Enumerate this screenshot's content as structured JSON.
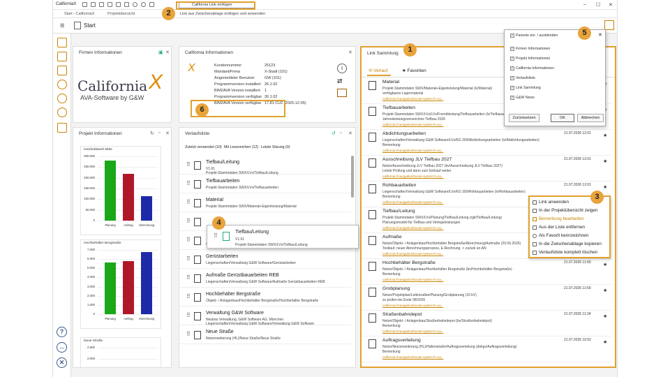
{
  "app": {
    "title": "CaliforniaX",
    "tab_start": "Start - CaliforniaX",
    "tab_projects": "Projektübersicht",
    "url_text": "California Link einfügen",
    "url_tooltip": "Link aus Zwischenablage einfügen und anwenden",
    "start": "Start"
  },
  "badges": [
    "1",
    "2",
    "3",
    "4",
    "5",
    "6"
  ],
  "firmen": {
    "title": "Firmen Informationen",
    "logo_word": "California",
    "logo_sub": "AVA-Software by G&W",
    "logo_x": "X"
  },
  "cinfo": {
    "title": "California Informationen",
    "rows": [
      {
        "k": "Kundennummer",
        "v": "25123"
      },
      {
        "k": "Mandant/Firma",
        "v": "X-Stadt (101)"
      },
      {
        "k": "Angemeldeter Benutzer",
        "v": "GW (101)"
      },
      {
        "k": "Programmversion installiert",
        "v": "26.1.02"
      },
      {
        "k": "BIM2AVA Version installiert",
        "v": "1"
      },
      {
        "k": "Programmversion verfügbar",
        "v": "26.1.02"
      },
      {
        "k": "BIM2AVA Version verfügbar",
        "v": "17.81 CU2 (2025-12-05)"
      }
    ]
  },
  "projekt": {
    "title": "Projekt Informationen",
    "charts": [
      {
        "title": "Heizkraftwerk Mitte",
        "yticks": [
          "300.000",
          "250.000",
          "200.000",
          "150.000",
          "100.000",
          "50.000",
          "0"
        ]
      },
      {
        "title": "Hochbehälter Bergstraße",
        "yticks": [
          "7.000",
          "6.000",
          "5.000",
          "4.000",
          "3.000",
          "2.000",
          "1.000",
          "0"
        ]
      },
      {
        "title": "Neue Straße",
        "yticks": [
          "2.500",
          "2.000"
        ]
      }
    ]
  },
  "chart_data": [
    {
      "type": "bar",
      "title": "Heizkraftwerk Mitte",
      "categories": [
        "Planung",
        "Auftrag",
        "Abrechnung"
      ],
      "values": [
        280000,
        220000,
        115000
      ],
      "ylim": [
        0,
        300000
      ],
      "colors": [
        "#1aa81a",
        "#b0182a",
        "#1c2aa8"
      ]
    },
    {
      "type": "bar",
      "title": "Hochbehälter Bergstraße",
      "categories": [
        "Planung",
        "Auftrag",
        "Abrechnung"
      ],
      "values": [
        5600,
        5800,
        6800
      ],
      "ylim": [
        0,
        7000
      ],
      "colors": [
        "#1aa81a",
        "#b0182a",
        "#1c2aa8"
      ]
    }
  ],
  "verlauf": {
    "title": "Verlaufsliste",
    "filters": [
      "Zuletzt verwendet (10)",
      "Mit Lesezeichen (12)",
      "Letzte Sitzung (0)"
    ],
    "items": [
      {
        "n": "Tiefbau/Leitung",
        "s": "V1.61",
        "s2": "Projekt-Stammdaten SWX/LVs/Tiefbau/Leitung"
      },
      {
        "n": "Tiefbauarbeiten",
        "s": "Projekt-Stammdaten SWX/LVs/Tiefbauarbeiten",
        "s2": ""
      },
      {
        "n": "Material",
        "s": "Projekt-Stammdaten SWX/Material+Eigenleistung/Material",
        "s2": ""
      },
      {
        "n": "",
        "s": "",
        "s2": ""
      },
      {
        "n": "",
        "s": "Objekt- / Anlagenbau/Heizkraftwerk Mitte/Heizkraftwerk Mitte",
        "s2": ""
      },
      {
        "n": "Gerüstarbeiten",
        "s": "Liegenschaften/Verwaltung G&W Software/Gerüstarbeiten",
        "s2": ""
      },
      {
        "n": "Aufmaße Gerüstbauarbeiten REB",
        "s": "Liegenschaften/Verwaltung G&W Software/Aufmaße Gerüstbauarbeiten REB",
        "s2": ""
      },
      {
        "n": "Hochbehälter Bergstraße",
        "s": "Objekt- / Anlagenbau/Hochbehälter Bergstraße/Hochbehälter Bergstraße",
        "s2": ""
      },
      {
        "n": "Verwaltung G&W Software",
        "s": "Neubau Verwaltung, G&W Software AG, München",
        "s2": "Liegenschaften/Verwaltung G&W Software/Verwaltung G&W Software"
      },
      {
        "n": "Neue Straße",
        "s": "Netzerweiterung (HL)/Neue Straße/Neue Straße",
        "s2": ""
      }
    ],
    "drag": {
      "n": "Tiefbau/Leitung",
      "s": "V1.61",
      "s2": "Projekt-Stammdaten SWX/LVs/Tiefbau/Leitung"
    }
  },
  "links": {
    "title": "Link Sammlung",
    "tab1": "Verlauf",
    "tab2": "Favoriten",
    "items": [
      {
        "n": "Material",
        "l1": "Projekt-Stammdaten SWX/Material+Eigenleistung/Material (lv/Material)",
        "l2": "verfügbares Lagermaterial",
        "lk": "california://navigation/locate-system?i=ey..."
      },
      {
        "n": "Tiefbauarbeiten",
        "l1": "Projekt-Stammdaten SWX/LVs/LVs/Fremdleistung/Tiefbauarbeiten (lv/Tiefbauarbeiten)",
        "l2": "Jahresleistungsverzeichnis Tiefbau 2026",
        "lk": "california://navigation/locate-system?i=ey..."
      },
      {
        "n": "Abdichtungsarbeiten",
        "d": "21.07.2026 12:01",
        "l1": "Liegenschaften/Verwaltung G&W Software/LVs/KG 300/Abdichtungsarbeiten (lv/Abdichtungsarbeiten)",
        "l2": "Bemerkung",
        "lk": "california://navigation/locate-system?i=ey..."
      },
      {
        "n": "Ausschreibung JLV Tiefbau 2027",
        "d": "21.07.2026 12:01",
        "l1": "Netze/Ausschreibung JLV Tiefbau 2027 (bv/Ausschreibung JLV Tiefbau 2027)",
        "l2": "Letzte Prüfung und dann zum Einkauf weiter",
        "lk": "california://navigation/locate-system?i=ey..."
      },
      {
        "n": "Rohbauarbeiten",
        "d": "21.07.2026 12:01",
        "l1": "Liegenschaften/Verwaltung G&W Software/LVs/KG 300/Rohbauarbeiten (lv/Rohbauarbeiten)",
        "l2": "Bemerkung",
        "lk": "california://navigation/locate-system?i=ey..."
      },
      {
        "n": "Tiefbau/Leitung",
        "d": "",
        "l1": "Projekt-Stammdaten SWX/LVs/Planung/Tiefbau/Leitung (rgb/Tiefbau/Leitung)",
        "l2": "Planungsmodell für Tiefbau und Verlegeleistungen",
        "lk": "california://navigation/locate-system?i=ey..."
      },
      {
        "n": "Aufmaße",
        "d": "",
        "l1": "Netze/Objekt- / Anlagenbau/Hochbehälter Bergstraße/Abrechnung/Aufmaße (29.06.2026)",
        "l2": "Testlauf, neuer Abrechnungsprozess, E-Rechnung -> zurück an AN",
        "lk": "california://navigation/locate-system?i=ey..."
      },
      {
        "n": "Hochbehälter Bergstraße",
        "d": "21.07.2026 11:59",
        "l1": "Netze/Objekt- / Anlagenbau/Hochbehälter Bergstraße (bv/Hochbehälter Bergstraße)",
        "l2": "Bemerkung",
        "lk": "california://navigation/locate-system?i=ey..."
      },
      {
        "n": "Grobplanung",
        "d": "21.07.2026 11:59",
        "l1": "Netze/Projektplan/Leibnizallee/Planung/Grobplanung (10 kV)",
        "l2": "zu prüfen bis Ende 08/2026",
        "lk": "california://navigation/locate-system?i=ey..."
      },
      {
        "n": "Straßenbahndepot",
        "d": "21.07.2026 11:24",
        "l1": "Netze/Objekt- / Anlagenbau/Straßenbahndepot (bv/Straßenbahndepot)",
        "l2": "Bemerkung",
        "lk": "california://navigation/locate-system?i=ey..."
      },
      {
        "n": "Auftragsverteilung",
        "d": "21.07.2026 10:52",
        "l1": "Netze/Netzerweiterung (HL)/Hafenstraße/Auftragsverteilung (dokgv/Auftragsverteilung)",
        "l2": "Bemerkung",
        "lk": "california://navigation/locate-system?i=ey..."
      }
    ]
  },
  "context": {
    "items": [
      "Link anwenden",
      "In der Projektübersicht zeigen",
      "Bemerkung bearbeiten",
      "Aus der Liste entfernen",
      "Als Favorit kennzeichnen",
      "In die Zwischenablage kopieren",
      "Verlaufsliste komplett löschen"
    ]
  },
  "panels": {
    "title": "Paneele ein- / ausblenden",
    "items": [
      "Firmen Informationen",
      "Projekt Informationen",
      "California Informationen",
      "Verlaufsliste",
      "Link Sammlung",
      "G&W News"
    ],
    "reset": "Zurücksetzen",
    "ok": "OK",
    "cancel": "Abbrechen"
  }
}
